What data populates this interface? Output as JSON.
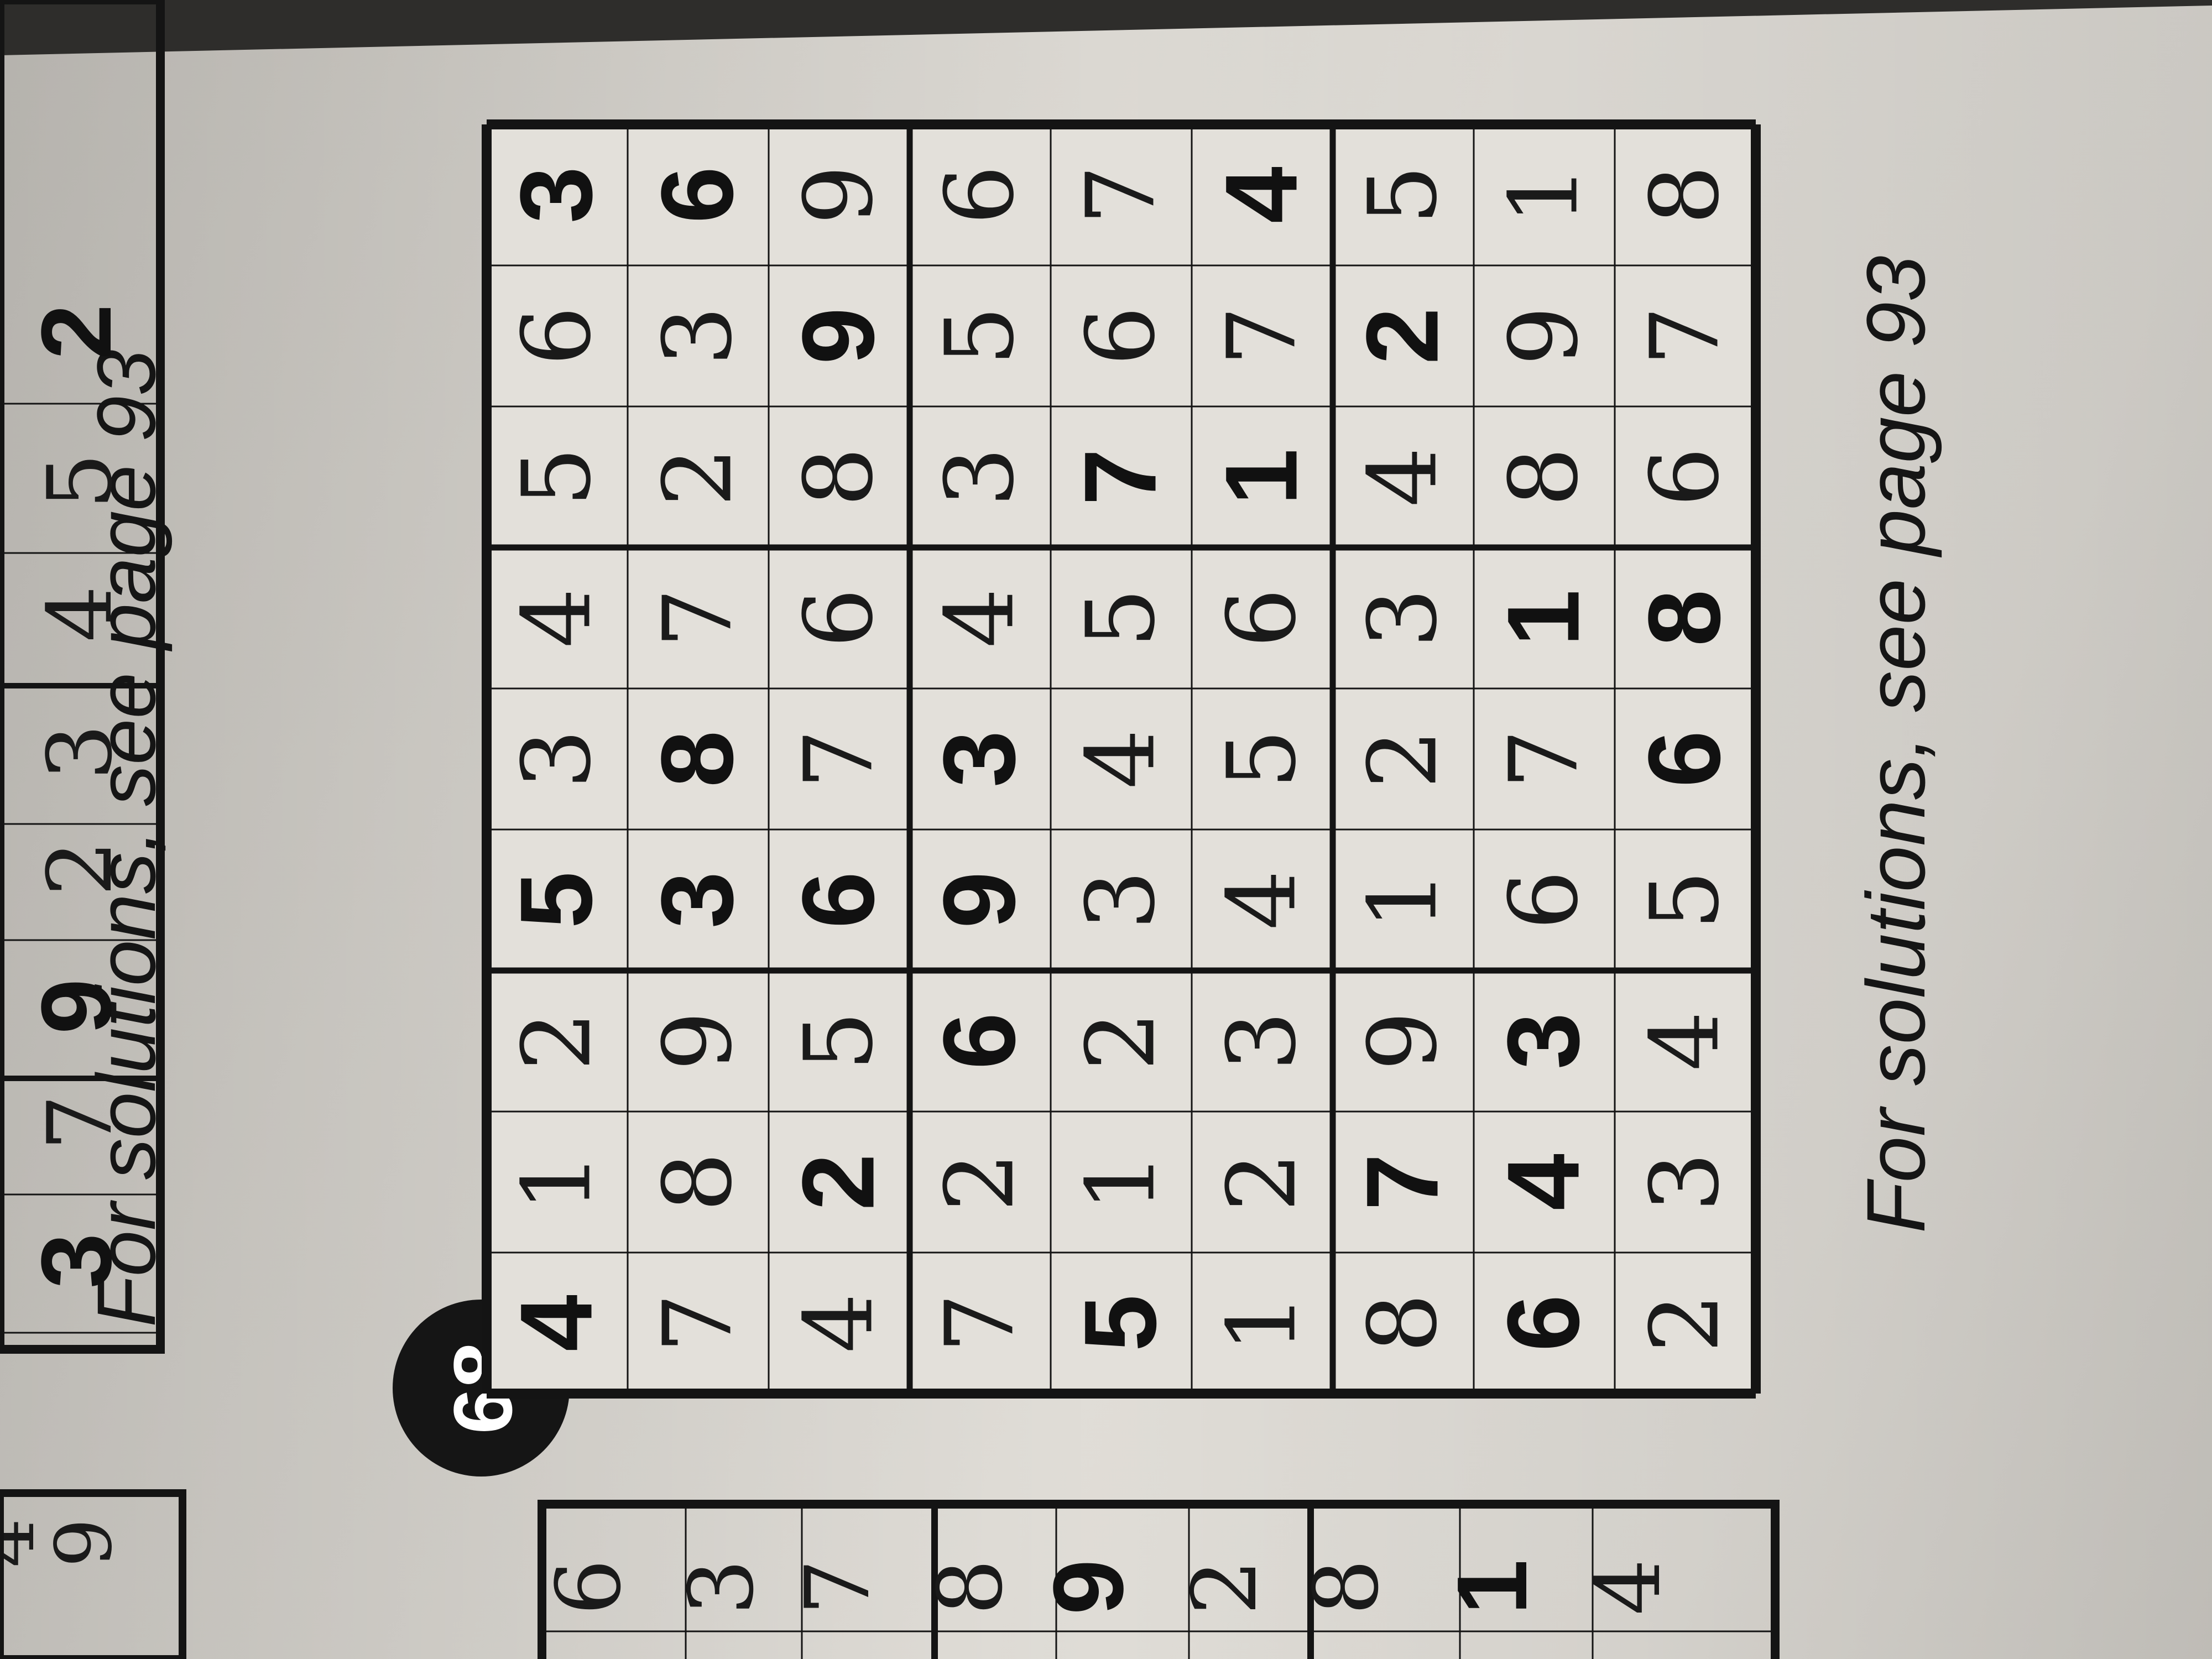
{
  "puzzle": {
    "number": "68",
    "grid": [
      [
        "4",
        "1",
        "2",
        "5",
        "3",
        "4",
        "5",
        "6",
        "3"
      ],
      [
        "7",
        "8",
        "9",
        "3",
        "8",
        "7",
        "2",
        "3",
        "6"
      ],
      [
        "4",
        "2",
        "5",
        "6",
        "7",
        "6",
        "8",
        "9",
        "9"
      ],
      [
        "7",
        "2",
        "6",
        "9",
        "3",
        "4",
        "3",
        "5",
        "6"
      ],
      [
        "5",
        "1",
        "2",
        "3",
        "4",
        "5",
        "7",
        "6",
        "7"
      ],
      [
        "1",
        "2",
        "3",
        "4",
        "5",
        "6",
        "1",
        "7",
        "4"
      ],
      [
        "8",
        "7",
        "9",
        "1",
        "2",
        "3",
        "4",
        "2",
        "5"
      ],
      [
        "6",
        "4",
        "3",
        "6",
        "7",
        "1",
        "8",
        "9",
        "1"
      ],
      [
        "2",
        "3",
        "4",
        "5",
        "6",
        "8",
        "6",
        "7",
        "8"
      ]
    ],
    "given": [
      [
        1,
        0,
        0,
        1,
        0,
        0,
        0,
        0,
        1
      ],
      [
        0,
        0,
        0,
        1,
        1,
        0,
        0,
        0,
        1
      ],
      [
        0,
        1,
        0,
        1,
        0,
        0,
        0,
        1,
        0
      ],
      [
        0,
        0,
        1,
        1,
        1,
        0,
        0,
        0,
        0
      ],
      [
        1,
        0,
        0,
        0,
        0,
        0,
        1,
        0,
        0
      ],
      [
        0,
        0,
        0,
        0,
        0,
        0,
        1,
        0,
        1
      ],
      [
        0,
        1,
        0,
        0,
        0,
        0,
        0,
        1,
        0
      ],
      [
        1,
        1,
        1,
        0,
        0,
        1,
        0,
        0,
        0
      ],
      [
        0,
        0,
        0,
        0,
        1,
        1,
        0,
        0,
        0
      ]
    ]
  },
  "captions": {
    "main": "For solutions, see page 93",
    "adjacent": "For solutions, see page 93"
  },
  "fragments": {
    "top_row": [
      "3",
      "7",
      "9",
      "2",
      "3",
      "4",
      "5",
      "2"
    ],
    "top_given": [
      1,
      0,
      1,
      0,
      0,
      0,
      0,
      1
    ],
    "bottom_col": [
      "6",
      "3",
      "7",
      "8",
      "9",
      "2",
      "8",
      "1",
      "4"
    ],
    "bottom_given": [
      0,
      0,
      0,
      0,
      1,
      0,
      0,
      1,
      0
    ],
    "bottom_extra": [
      "4",
      "9"
    ]
  }
}
